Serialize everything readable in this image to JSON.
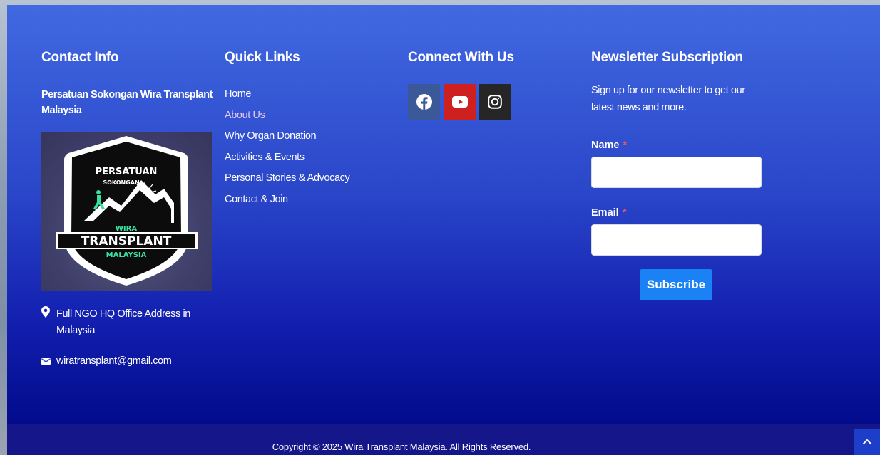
{
  "contact": {
    "title": "Contact Info",
    "org_name": "Persatuan Sokongan Wira Transplant Malaysia",
    "address": "Full NGO HQ Office Address in Malaysia",
    "email": "wiratransplant@gmail.com",
    "logo": {
      "top_text": "PERSATUAN",
      "mid_text": "SOKONGAN",
      "wira": "WIRA",
      "transplant": "TRANSPLANT",
      "malaysia": "MALAYSIA"
    }
  },
  "quick_links": {
    "title": "Quick Links",
    "items": [
      {
        "label": "Home"
      },
      {
        "label": "About Us"
      },
      {
        "label": "Why Organ Donation"
      },
      {
        "label": "Activities & Events"
      },
      {
        "label": "Personal Stories & Advocacy"
      },
      {
        "label": "Contact & Join"
      }
    ],
    "active_index": 1
  },
  "connect": {
    "title": "Connect With Us",
    "socials": [
      {
        "icon": "facebook-icon",
        "color": "#3b5998"
      },
      {
        "icon": "youtube-icon",
        "color": "#cd201f"
      },
      {
        "icon": "instagram-icon",
        "color": "#262626"
      }
    ]
  },
  "newsletter": {
    "title": "Newsletter Subscription",
    "description": "Sign up for our newsletter to get our latest news and more.",
    "name_label": "Name",
    "email_label": "Email",
    "required_mark": "*",
    "name_value": "",
    "email_value": "",
    "button_label": "Subscribe"
  },
  "footer": {
    "copyright": "Copyright © 2025 Wira Transplant Malaysia. All Rights Reserved."
  },
  "colors": {
    "gradient_top": "#4169e1",
    "gradient_bottom": "#020b8c",
    "bottom_bar": "#14168a",
    "subscribe_button": "#1a82f5",
    "active_link": "#e8c9f2"
  }
}
